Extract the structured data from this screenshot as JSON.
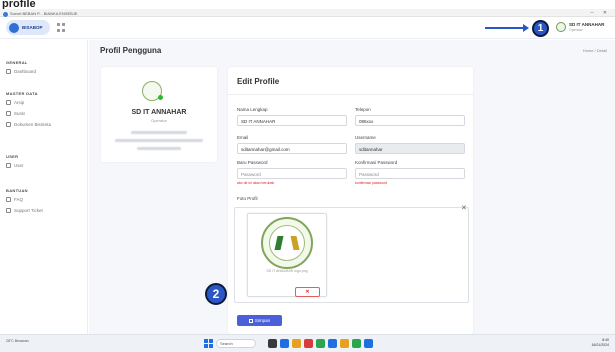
{
  "caption": "profile",
  "browser": {
    "tab_title": "Survei BEBAN P... BIANKA ENSEBJE"
  },
  "header": {
    "logo_text": "BISABOP",
    "user": {
      "name": "SD IT ANNAHAR",
      "role": "Operator"
    },
    "markers": {
      "one": "1",
      "two": "2"
    }
  },
  "sidebar": {
    "sections": [
      {
        "title": "GENERAL",
        "items": [
          {
            "label": "Dashboard",
            "icon": "home-icon"
          }
        ]
      },
      {
        "title": "MASTER DATA",
        "items": [
          {
            "label": "Arsip",
            "icon": "folder-icon"
          },
          {
            "label": "Surat",
            "icon": "mail-icon"
          },
          {
            "label": "Dokumen Bisnisku",
            "icon": "document-icon"
          }
        ]
      },
      {
        "title": "USER",
        "items": [
          {
            "label": "User",
            "icon": "user-icon"
          }
        ]
      },
      {
        "title": "BANTUAN",
        "items": [
          {
            "label": "FAQ",
            "icon": "help-icon"
          },
          {
            "label": "Support Ticket",
            "icon": "ticket-icon"
          }
        ]
      }
    ]
  },
  "page": {
    "title": "Profil Pengguna",
    "breadcrumb": "Home / Detail"
  },
  "profile_card": {
    "name": "SD IT ANNAHAR",
    "role": "Operator"
  },
  "form": {
    "title": "Edit Profile",
    "fields": {
      "nama_lengkap": {
        "label": "Nama Lengkap",
        "value": "SD IT ANNAHAR"
      },
      "telepon": {
        "label": "Telepon",
        "value": "085xxx"
      },
      "email": {
        "label": "Email",
        "value": "sditannahar@gmail.com"
      },
      "username": {
        "label": "Username",
        "value": "sditannahar"
      },
      "baru_password": {
        "label": "Baru Password",
        "placeholder": "Password",
        "hint": "abc de ini akan berubah"
      },
      "konfirmasi_password": {
        "label": "Konfirmasi Password",
        "placeholder": "Password",
        "hint": "konfirmasi password"
      }
    },
    "photo": {
      "label": "Foto Profil",
      "caption": "SD IT ANNAHAR logo.png",
      "remove_label": "✕",
      "close_label": "✕"
    },
    "save_label": "Simpan"
  },
  "taskbar": {
    "weather": "28°C Berawan",
    "search": "Search",
    "time": "8:40",
    "date": "16/01/2024",
    "app_colors": [
      "#3a3a3a",
      "#1f6fe0",
      "#e8a020",
      "#d83b3b",
      "#2da44e",
      "#1f6fe0",
      "#e8a020",
      "#2da44e",
      "#1f6fe0"
    ]
  }
}
